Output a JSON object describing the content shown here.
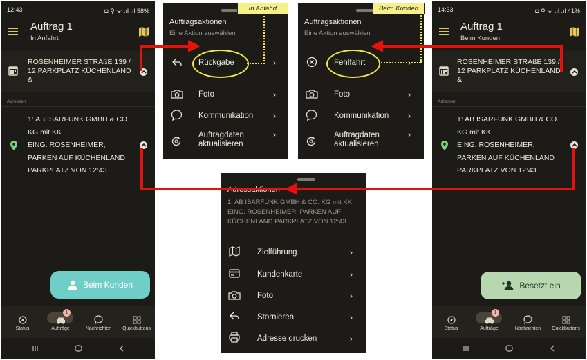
{
  "left_phone": {
    "status_time": "12:43",
    "status_icons": "◘ ⚲ ᯤ .ıl .ıl 58%",
    "title": "Auftrag 1",
    "subtitle": "In Anfahrt",
    "address_line1": "ROSENHEIMER STRAßE 139 /",
    "address_line2": "12 PARKPLATZ KÜCHENLAND",
    "address_line3": "&",
    "section_label": "Adressen",
    "stop_lines": [
      "1: AB ISARFUNK GMBH & CO.",
      "KG mit KK",
      "EING. ROSENHEIMER,",
      "PARKEN AUF KÜCHENLAND",
      "PARKPLATZ VON 12:43"
    ],
    "fab_label": "Beim Kunden",
    "nav": [
      "Status",
      "Aufträge",
      "Nachrichten",
      "Quickbuttons"
    ],
    "badge": "1"
  },
  "right_phone": {
    "status_time": "14:33",
    "status_icons": "◘ ⚲ ᯤ .ıl .ıl 41%",
    "title": "Auftrag 1",
    "subtitle": "Beim Kunden",
    "address_line1": "ROSENHEIMER STRAßE 139 /",
    "address_line2": "12 PARKPLATZ KÜCHENLAND",
    "address_line3": "&",
    "section_label": "Adressen",
    "stop_lines": [
      "1: AB ISARFUNK GMBH & CO.",
      "KG mit KK",
      "EING. ROSENHEIMER,",
      "PARKEN AUF KÜCHENLAND",
      "PARKPLATZ VON 12:43"
    ],
    "fab_label": "Besetzt ein",
    "nav": [
      "Status",
      "Aufträge",
      "Nachrichten",
      "Quickbuttons"
    ],
    "badge": "1"
  },
  "sheet_anfahrt": {
    "tag": "In Anfahrt",
    "title": "Auftragsaktionen",
    "subtitle": "Eine Aktion auswählen",
    "items": [
      "Rückgabe",
      "Foto",
      "Kommunikation",
      "Auftragdaten",
      "aktualisieren"
    ]
  },
  "sheet_kunden": {
    "tag": "Beim Kunden",
    "title": "Auftragsaktionen",
    "subtitle": "Eine Aktion auswählen",
    "items": [
      "Fehlfahrt",
      "Foto",
      "Kommunikation",
      "Auftragdaten",
      "aktualisieren"
    ]
  },
  "sheet_address": {
    "title": "Adressaktionen",
    "desc_lines": [
      "1: AB ISARFUNK GMBH & CO. KG mit KK",
      "EING. ROSENHEIMER, PARKEN AUF",
      "KÜCHENLAND PARKPLATZ VON 12:43"
    ],
    "items": [
      "Zielführung",
      "Kundenkarte",
      "Foto",
      "Stornieren",
      "Adresse drucken"
    ]
  },
  "colors": {
    "background": "#1c1b17",
    "accent_yellow": "#e3c95a",
    "fab_teal": "#6fcfc8",
    "fab_green": "#b7d7b0",
    "arrow_red": "#e3120b",
    "highlight_yellow": "#f2e64a"
  }
}
